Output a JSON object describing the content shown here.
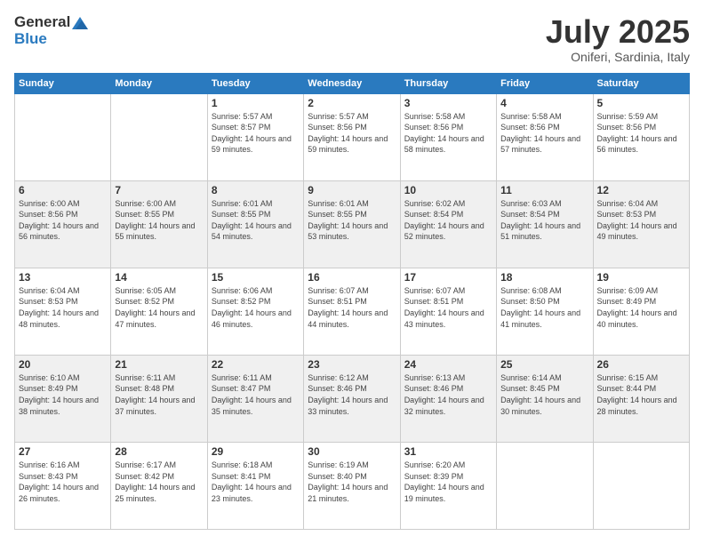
{
  "header": {
    "logo_general": "General",
    "logo_blue": "Blue",
    "month": "July 2025",
    "location": "Oniferi, Sardinia, Italy"
  },
  "days_of_week": [
    "Sunday",
    "Monday",
    "Tuesday",
    "Wednesday",
    "Thursday",
    "Friday",
    "Saturday"
  ],
  "weeks": [
    [
      {
        "day": "",
        "info": ""
      },
      {
        "day": "",
        "info": ""
      },
      {
        "day": "1",
        "sunrise": "Sunrise: 5:57 AM",
        "sunset": "Sunset: 8:57 PM",
        "daylight": "Daylight: 14 hours and 59 minutes."
      },
      {
        "day": "2",
        "sunrise": "Sunrise: 5:57 AM",
        "sunset": "Sunset: 8:56 PM",
        "daylight": "Daylight: 14 hours and 59 minutes."
      },
      {
        "day": "3",
        "sunrise": "Sunrise: 5:58 AM",
        "sunset": "Sunset: 8:56 PM",
        "daylight": "Daylight: 14 hours and 58 minutes."
      },
      {
        "day": "4",
        "sunrise": "Sunrise: 5:58 AM",
        "sunset": "Sunset: 8:56 PM",
        "daylight": "Daylight: 14 hours and 57 minutes."
      },
      {
        "day": "5",
        "sunrise": "Sunrise: 5:59 AM",
        "sunset": "Sunset: 8:56 PM",
        "daylight": "Daylight: 14 hours and 56 minutes."
      }
    ],
    [
      {
        "day": "6",
        "sunrise": "Sunrise: 6:00 AM",
        "sunset": "Sunset: 8:56 PM",
        "daylight": "Daylight: 14 hours and 56 minutes."
      },
      {
        "day": "7",
        "sunrise": "Sunrise: 6:00 AM",
        "sunset": "Sunset: 8:55 PM",
        "daylight": "Daylight: 14 hours and 55 minutes."
      },
      {
        "day": "8",
        "sunrise": "Sunrise: 6:01 AM",
        "sunset": "Sunset: 8:55 PM",
        "daylight": "Daylight: 14 hours and 54 minutes."
      },
      {
        "day": "9",
        "sunrise": "Sunrise: 6:01 AM",
        "sunset": "Sunset: 8:55 PM",
        "daylight": "Daylight: 14 hours and 53 minutes."
      },
      {
        "day": "10",
        "sunrise": "Sunrise: 6:02 AM",
        "sunset": "Sunset: 8:54 PM",
        "daylight": "Daylight: 14 hours and 52 minutes."
      },
      {
        "day": "11",
        "sunrise": "Sunrise: 6:03 AM",
        "sunset": "Sunset: 8:54 PM",
        "daylight": "Daylight: 14 hours and 51 minutes."
      },
      {
        "day": "12",
        "sunrise": "Sunrise: 6:04 AM",
        "sunset": "Sunset: 8:53 PM",
        "daylight": "Daylight: 14 hours and 49 minutes."
      }
    ],
    [
      {
        "day": "13",
        "sunrise": "Sunrise: 6:04 AM",
        "sunset": "Sunset: 8:53 PM",
        "daylight": "Daylight: 14 hours and 48 minutes."
      },
      {
        "day": "14",
        "sunrise": "Sunrise: 6:05 AM",
        "sunset": "Sunset: 8:52 PM",
        "daylight": "Daylight: 14 hours and 47 minutes."
      },
      {
        "day": "15",
        "sunrise": "Sunrise: 6:06 AM",
        "sunset": "Sunset: 8:52 PM",
        "daylight": "Daylight: 14 hours and 46 minutes."
      },
      {
        "day": "16",
        "sunrise": "Sunrise: 6:07 AM",
        "sunset": "Sunset: 8:51 PM",
        "daylight": "Daylight: 14 hours and 44 minutes."
      },
      {
        "day": "17",
        "sunrise": "Sunrise: 6:07 AM",
        "sunset": "Sunset: 8:51 PM",
        "daylight": "Daylight: 14 hours and 43 minutes."
      },
      {
        "day": "18",
        "sunrise": "Sunrise: 6:08 AM",
        "sunset": "Sunset: 8:50 PM",
        "daylight": "Daylight: 14 hours and 41 minutes."
      },
      {
        "day": "19",
        "sunrise": "Sunrise: 6:09 AM",
        "sunset": "Sunset: 8:49 PM",
        "daylight": "Daylight: 14 hours and 40 minutes."
      }
    ],
    [
      {
        "day": "20",
        "sunrise": "Sunrise: 6:10 AM",
        "sunset": "Sunset: 8:49 PM",
        "daylight": "Daylight: 14 hours and 38 minutes."
      },
      {
        "day": "21",
        "sunrise": "Sunrise: 6:11 AM",
        "sunset": "Sunset: 8:48 PM",
        "daylight": "Daylight: 14 hours and 37 minutes."
      },
      {
        "day": "22",
        "sunrise": "Sunrise: 6:11 AM",
        "sunset": "Sunset: 8:47 PM",
        "daylight": "Daylight: 14 hours and 35 minutes."
      },
      {
        "day": "23",
        "sunrise": "Sunrise: 6:12 AM",
        "sunset": "Sunset: 8:46 PM",
        "daylight": "Daylight: 14 hours and 33 minutes."
      },
      {
        "day": "24",
        "sunrise": "Sunrise: 6:13 AM",
        "sunset": "Sunset: 8:46 PM",
        "daylight": "Daylight: 14 hours and 32 minutes."
      },
      {
        "day": "25",
        "sunrise": "Sunrise: 6:14 AM",
        "sunset": "Sunset: 8:45 PM",
        "daylight": "Daylight: 14 hours and 30 minutes."
      },
      {
        "day": "26",
        "sunrise": "Sunrise: 6:15 AM",
        "sunset": "Sunset: 8:44 PM",
        "daylight": "Daylight: 14 hours and 28 minutes."
      }
    ],
    [
      {
        "day": "27",
        "sunrise": "Sunrise: 6:16 AM",
        "sunset": "Sunset: 8:43 PM",
        "daylight": "Daylight: 14 hours and 26 minutes."
      },
      {
        "day": "28",
        "sunrise": "Sunrise: 6:17 AM",
        "sunset": "Sunset: 8:42 PM",
        "daylight": "Daylight: 14 hours and 25 minutes."
      },
      {
        "day": "29",
        "sunrise": "Sunrise: 6:18 AM",
        "sunset": "Sunset: 8:41 PM",
        "daylight": "Daylight: 14 hours and 23 minutes."
      },
      {
        "day": "30",
        "sunrise": "Sunrise: 6:19 AM",
        "sunset": "Sunset: 8:40 PM",
        "daylight": "Daylight: 14 hours and 21 minutes."
      },
      {
        "day": "31",
        "sunrise": "Sunrise: 6:20 AM",
        "sunset": "Sunset: 8:39 PM",
        "daylight": "Daylight: 14 hours and 19 minutes."
      },
      {
        "day": "",
        "info": ""
      },
      {
        "day": "",
        "info": ""
      }
    ]
  ]
}
